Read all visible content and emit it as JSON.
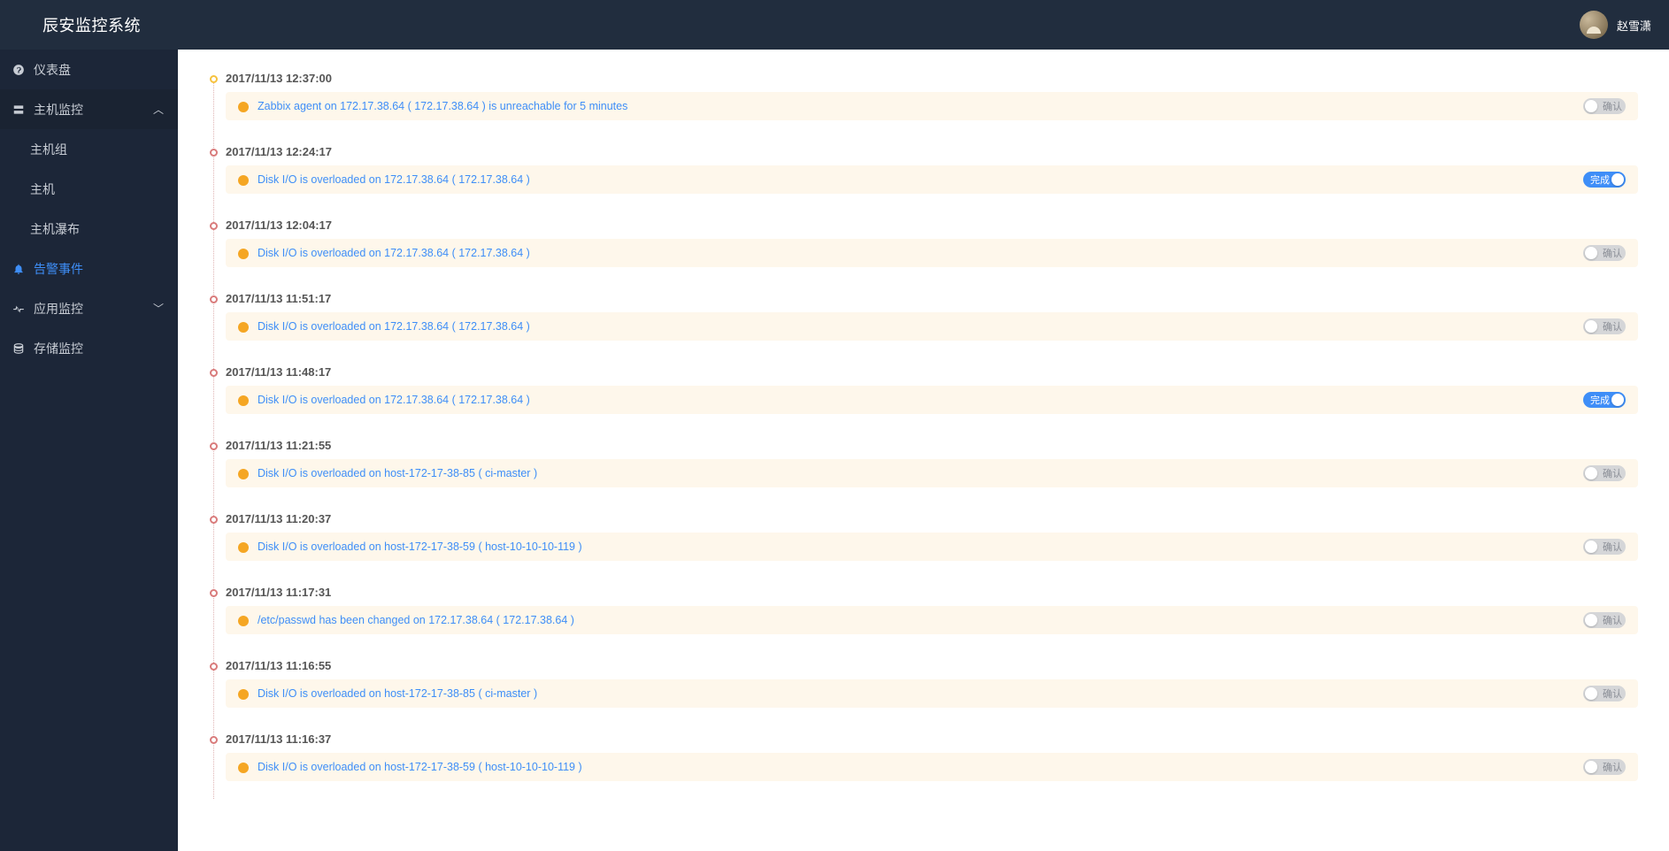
{
  "header": {
    "logo": "辰安监控系统",
    "username": "赵雪潇"
  },
  "sidebar": {
    "dashboard": "仪表盘",
    "host_monitor": "主机监控",
    "host_group": "主机组",
    "host": "主机",
    "host_waterfall": "主机瀑布",
    "alarm_events": "告警事件",
    "app_monitor": "应用监控",
    "storage_monitor": "存储监控"
  },
  "toggle_labels": {
    "off": "确认",
    "on": "完成"
  },
  "events": [
    {
      "time": "2017/11/13 12:37:00",
      "msg": "Zabbix agent on 172.17.38.64 ( 172.17.38.64 ) is unreachable for 5 minutes",
      "state": "off",
      "first": true
    },
    {
      "time": "2017/11/13 12:24:17",
      "msg": "Disk I/O is overloaded on 172.17.38.64 ( 172.17.38.64 )",
      "state": "on"
    },
    {
      "time": "2017/11/13 12:04:17",
      "msg": "Disk I/O is overloaded on 172.17.38.64 ( 172.17.38.64 )",
      "state": "off"
    },
    {
      "time": "2017/11/13 11:51:17",
      "msg": "Disk I/O is overloaded on 172.17.38.64 ( 172.17.38.64 )",
      "state": "off"
    },
    {
      "time": "2017/11/13 11:48:17",
      "msg": "Disk I/O is overloaded on 172.17.38.64 ( 172.17.38.64 )",
      "state": "on"
    },
    {
      "time": "2017/11/13 11:21:55",
      "msg": "Disk I/O is overloaded on host-172-17-38-85 ( ci-master )",
      "state": "off"
    },
    {
      "time": "2017/11/13 11:20:37",
      "msg": "Disk I/O is overloaded on host-172-17-38-59 ( host-10-10-10-119 )",
      "state": "off"
    },
    {
      "time": "2017/11/13 11:17:31",
      "msg": "/etc/passwd has been changed on 172.17.38.64 ( 172.17.38.64 )",
      "state": "off"
    },
    {
      "time": "2017/11/13 11:16:55",
      "msg": "Disk I/O is overloaded on host-172-17-38-85 ( ci-master )",
      "state": "off"
    },
    {
      "time": "2017/11/13 11:16:37",
      "msg": "Disk I/O is overloaded on host-172-17-38-59 ( host-10-10-10-119 )",
      "state": "off"
    }
  ]
}
